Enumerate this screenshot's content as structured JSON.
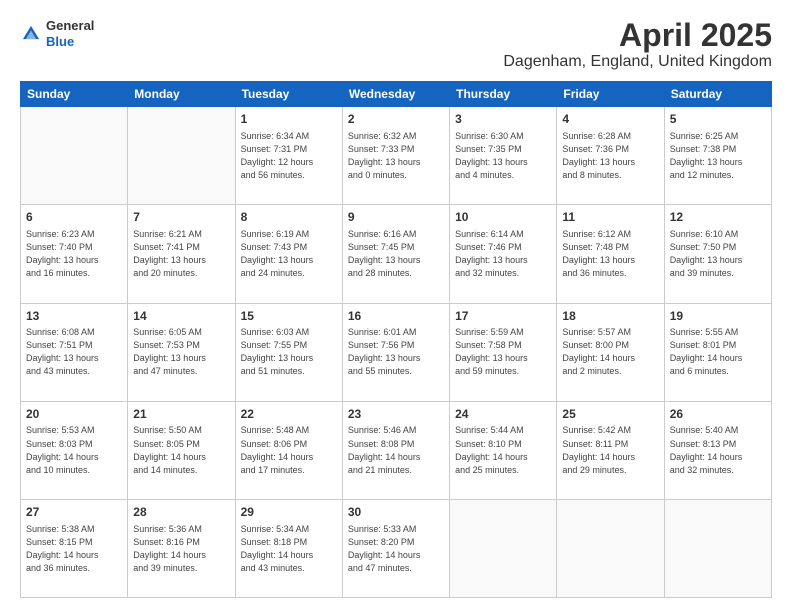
{
  "header": {
    "logo": {
      "general": "General",
      "blue": "Blue"
    },
    "title": "April 2025",
    "subtitle": "Dagenham, England, United Kingdom"
  },
  "calendar": {
    "days_of_week": [
      "Sunday",
      "Monday",
      "Tuesday",
      "Wednesday",
      "Thursday",
      "Friday",
      "Saturday"
    ],
    "weeks": [
      [
        {
          "day": "",
          "info": ""
        },
        {
          "day": "",
          "info": ""
        },
        {
          "day": "1",
          "info": "Sunrise: 6:34 AM\nSunset: 7:31 PM\nDaylight: 12 hours\nand 56 minutes."
        },
        {
          "day": "2",
          "info": "Sunrise: 6:32 AM\nSunset: 7:33 PM\nDaylight: 13 hours\nand 0 minutes."
        },
        {
          "day": "3",
          "info": "Sunrise: 6:30 AM\nSunset: 7:35 PM\nDaylight: 13 hours\nand 4 minutes."
        },
        {
          "day": "4",
          "info": "Sunrise: 6:28 AM\nSunset: 7:36 PM\nDaylight: 13 hours\nand 8 minutes."
        },
        {
          "day": "5",
          "info": "Sunrise: 6:25 AM\nSunset: 7:38 PM\nDaylight: 13 hours\nand 12 minutes."
        }
      ],
      [
        {
          "day": "6",
          "info": "Sunrise: 6:23 AM\nSunset: 7:40 PM\nDaylight: 13 hours\nand 16 minutes."
        },
        {
          "day": "7",
          "info": "Sunrise: 6:21 AM\nSunset: 7:41 PM\nDaylight: 13 hours\nand 20 minutes."
        },
        {
          "day": "8",
          "info": "Sunrise: 6:19 AM\nSunset: 7:43 PM\nDaylight: 13 hours\nand 24 minutes."
        },
        {
          "day": "9",
          "info": "Sunrise: 6:16 AM\nSunset: 7:45 PM\nDaylight: 13 hours\nand 28 minutes."
        },
        {
          "day": "10",
          "info": "Sunrise: 6:14 AM\nSunset: 7:46 PM\nDaylight: 13 hours\nand 32 minutes."
        },
        {
          "day": "11",
          "info": "Sunrise: 6:12 AM\nSunset: 7:48 PM\nDaylight: 13 hours\nand 36 minutes."
        },
        {
          "day": "12",
          "info": "Sunrise: 6:10 AM\nSunset: 7:50 PM\nDaylight: 13 hours\nand 39 minutes."
        }
      ],
      [
        {
          "day": "13",
          "info": "Sunrise: 6:08 AM\nSunset: 7:51 PM\nDaylight: 13 hours\nand 43 minutes."
        },
        {
          "day": "14",
          "info": "Sunrise: 6:05 AM\nSunset: 7:53 PM\nDaylight: 13 hours\nand 47 minutes."
        },
        {
          "day": "15",
          "info": "Sunrise: 6:03 AM\nSunset: 7:55 PM\nDaylight: 13 hours\nand 51 minutes."
        },
        {
          "day": "16",
          "info": "Sunrise: 6:01 AM\nSunset: 7:56 PM\nDaylight: 13 hours\nand 55 minutes."
        },
        {
          "day": "17",
          "info": "Sunrise: 5:59 AM\nSunset: 7:58 PM\nDaylight: 13 hours\nand 59 minutes."
        },
        {
          "day": "18",
          "info": "Sunrise: 5:57 AM\nSunset: 8:00 PM\nDaylight: 14 hours\nand 2 minutes."
        },
        {
          "day": "19",
          "info": "Sunrise: 5:55 AM\nSunset: 8:01 PM\nDaylight: 14 hours\nand 6 minutes."
        }
      ],
      [
        {
          "day": "20",
          "info": "Sunrise: 5:53 AM\nSunset: 8:03 PM\nDaylight: 14 hours\nand 10 minutes."
        },
        {
          "day": "21",
          "info": "Sunrise: 5:50 AM\nSunset: 8:05 PM\nDaylight: 14 hours\nand 14 minutes."
        },
        {
          "day": "22",
          "info": "Sunrise: 5:48 AM\nSunset: 8:06 PM\nDaylight: 14 hours\nand 17 minutes."
        },
        {
          "day": "23",
          "info": "Sunrise: 5:46 AM\nSunset: 8:08 PM\nDaylight: 14 hours\nand 21 minutes."
        },
        {
          "day": "24",
          "info": "Sunrise: 5:44 AM\nSunset: 8:10 PM\nDaylight: 14 hours\nand 25 minutes."
        },
        {
          "day": "25",
          "info": "Sunrise: 5:42 AM\nSunset: 8:11 PM\nDaylight: 14 hours\nand 29 minutes."
        },
        {
          "day": "26",
          "info": "Sunrise: 5:40 AM\nSunset: 8:13 PM\nDaylight: 14 hours\nand 32 minutes."
        }
      ],
      [
        {
          "day": "27",
          "info": "Sunrise: 5:38 AM\nSunset: 8:15 PM\nDaylight: 14 hours\nand 36 minutes."
        },
        {
          "day": "28",
          "info": "Sunrise: 5:36 AM\nSunset: 8:16 PM\nDaylight: 14 hours\nand 39 minutes."
        },
        {
          "day": "29",
          "info": "Sunrise: 5:34 AM\nSunset: 8:18 PM\nDaylight: 14 hours\nand 43 minutes."
        },
        {
          "day": "30",
          "info": "Sunrise: 5:33 AM\nSunset: 8:20 PM\nDaylight: 14 hours\nand 47 minutes."
        },
        {
          "day": "",
          "info": ""
        },
        {
          "day": "",
          "info": ""
        },
        {
          "day": "",
          "info": ""
        }
      ]
    ]
  }
}
